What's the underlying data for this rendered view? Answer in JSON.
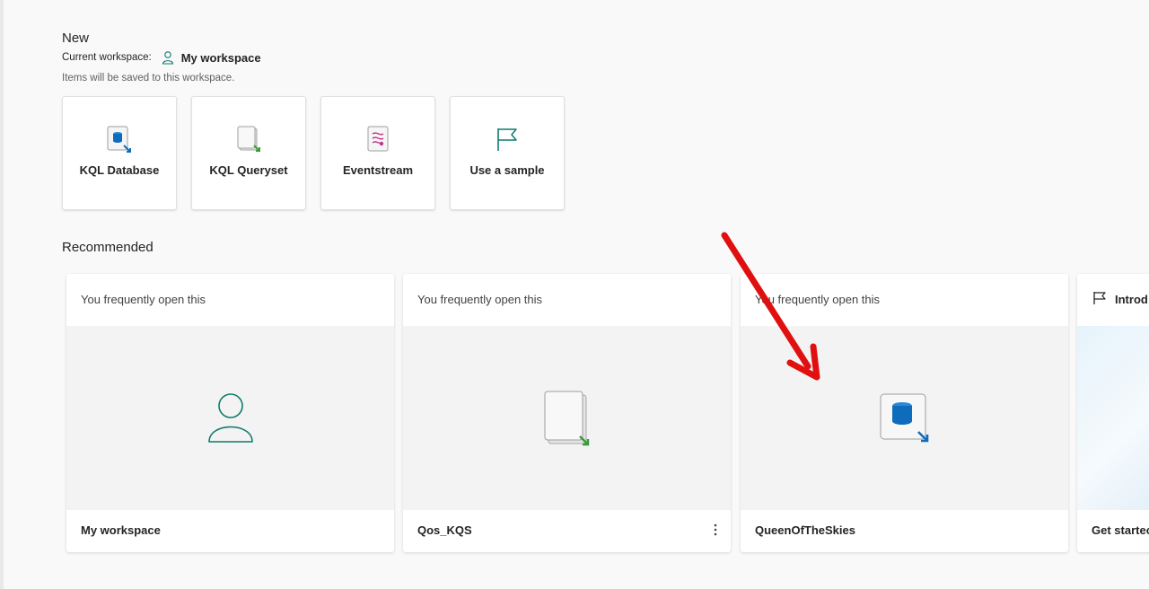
{
  "new_section": {
    "title": "New",
    "current_workspace_label": "Current workspace:",
    "workspace_name": "My workspace",
    "note": "Items will be saved to this workspace.",
    "cards": [
      {
        "label": "KQL Database",
        "icon": "kql-database-icon"
      },
      {
        "label": "KQL Queryset",
        "icon": "kql-queryset-icon"
      },
      {
        "label": "Eventstream",
        "icon": "eventstream-icon"
      },
      {
        "label": "Use a sample",
        "icon": "flag-icon"
      }
    ]
  },
  "recommended": {
    "title": "Recommended",
    "cards": [
      {
        "reason": "You frequently open this",
        "name": "My workspace",
        "icon": "workspace-person-icon"
      },
      {
        "reason": "You frequently open this",
        "name": "Qos_KQS",
        "icon": "kql-queryset-icon",
        "has_more": true
      },
      {
        "reason": "You frequently open this",
        "name": "QueenOfTheSkies",
        "icon": "kql-database-icon"
      },
      {
        "intro": "Introd",
        "name": "Get startec",
        "icon": "flag-icon"
      }
    ]
  },
  "colors": {
    "accent_green": "#0f7b6c",
    "annotation_arrow": "#e01010"
  }
}
